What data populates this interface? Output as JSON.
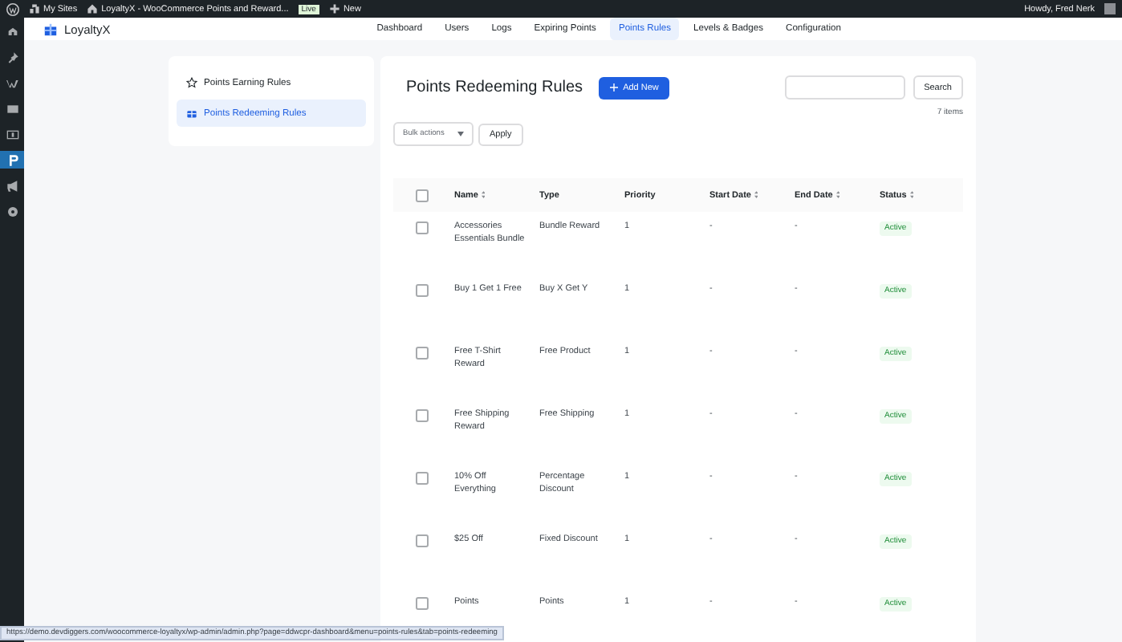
{
  "admin_bar": {
    "my_sites": "My Sites",
    "site_title": "LoyaltyX - WooCommerce Points and Reward...",
    "badge": "Live",
    "new": "New",
    "greeting": "Howdy, Fred Nerk"
  },
  "wp_menu": [
    {
      "kind": "home",
      "selected": false
    },
    {
      "kind": "pin",
      "selected": false
    },
    {
      "kind": "woo",
      "selected": false
    },
    {
      "kind": "mail",
      "selected": false
    },
    {
      "kind": "money",
      "selected": false
    },
    {
      "kind": "loyalty",
      "selected": true
    },
    {
      "kind": "megaphone",
      "selected": false
    },
    {
      "kind": "gear",
      "selected": false
    }
  ],
  "header": {
    "brand": "LoyaltyX",
    "nav": [
      {
        "label": "Dashboard",
        "selected": false
      },
      {
        "label": "Users",
        "selected": false
      },
      {
        "label": "Logs",
        "selected": false
      },
      {
        "label": "Expiring Points",
        "selected": false
      },
      {
        "label": "Points Rules",
        "selected": true
      },
      {
        "label": "Levels & Badges",
        "selected": false
      },
      {
        "label": "Configuration",
        "selected": false
      }
    ]
  },
  "side_menu": [
    {
      "label": "Points Earning Rules",
      "kind": "star",
      "selected": false
    },
    {
      "label": "Points Redeeming Rules",
      "kind": "gift",
      "selected": true
    }
  ],
  "main": {
    "title": "Points Redeeming Rules",
    "add_button": "Add New",
    "search_button": "Search",
    "bulk_actions": "Bulk actions",
    "apply_button": "Apply",
    "count": "7 items"
  },
  "table": {
    "select_all_checked": false,
    "columns": [
      {
        "label": "Name",
        "sortable": true
      },
      {
        "label": "Type",
        "sortable": false
      },
      {
        "label": "Priority",
        "sortable": false
      },
      {
        "label": "Start Date",
        "sortable": true
      },
      {
        "label": "End Date",
        "sortable": true
      },
      {
        "label": "Status",
        "sortable": true
      }
    ],
    "rows": [
      {
        "checked": false,
        "name": "Accessories Essentials Bundle",
        "type": "Bundle Reward",
        "priority": "1",
        "start": "-",
        "end": "-",
        "status": "Active"
      },
      {
        "checked": false,
        "name": "Buy 1 Get 1 Free",
        "type": "Buy X Get Y",
        "priority": "1",
        "start": "-",
        "end": "-",
        "status": "Active"
      },
      {
        "checked": false,
        "name": "Free T-Shirt Reward",
        "type": "Free Product",
        "priority": "1",
        "start": "-",
        "end": "-",
        "status": "Active"
      },
      {
        "checked": false,
        "name": "Free Shipping Reward",
        "type": "Free Shipping",
        "priority": "1",
        "start": "-",
        "end": "-",
        "status": "Active"
      },
      {
        "checked": false,
        "name": "10% Off Everything",
        "type": "Percentage Discount",
        "priority": "1",
        "start": "-",
        "end": "-",
        "status": "Active"
      },
      {
        "checked": false,
        "name": "$25 Off",
        "type": "Fixed Discount",
        "priority": "1",
        "start": "-",
        "end": "-",
        "status": "Active"
      },
      {
        "checked": false,
        "name": "Points",
        "type": "Points",
        "priority": "1",
        "start": "-",
        "end": "-",
        "status": "Active"
      }
    ]
  },
  "status_url": "https://demo.devdiggers.com/woocommerce-loyaltyx/wp-admin/admin.php?page=ddwcpr-dashboard&menu=points-rules&tab=points-redeeming"
}
